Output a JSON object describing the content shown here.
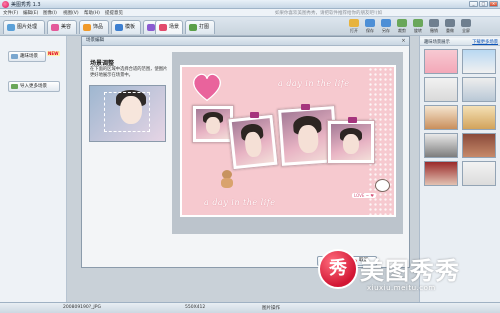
{
  "window": {
    "title": "美图秀秀 1.3",
    "controls": [
      "_",
      "□",
      "×"
    ]
  },
  "menu": {
    "items": [
      "文件(F)",
      "编辑(E)",
      "图像(I)",
      "视图(V)",
      "帮助(H)",
      "提提意见"
    ],
    "notice": "如果你喜欢美图秀秀，请把软件推荐给你的朋友吧!(如"
  },
  "tabs": [
    {
      "label": "图片处理",
      "color": "#5aa0d8"
    },
    {
      "label": "美容",
      "color": "#e45a9a"
    },
    {
      "label": "饰品",
      "color": "#f09a2a"
    },
    {
      "label": "模板",
      "color": "#3d7fd0"
    },
    {
      "label": "闪图",
      "color": "#8b5bd1"
    },
    {
      "label": "场景",
      "color": "#e24a6c"
    },
    {
      "label": "打图",
      "color": "#5b9f48"
    }
  ],
  "toolbar": {
    "buttons": [
      {
        "label": "打开",
        "color": "#e7b33e"
      },
      {
        "label": "保存",
        "color": "#4d8fd6"
      },
      {
        "label": "另存",
        "color": "#4d8fd6"
      },
      {
        "label": "裁剪",
        "color": "#6aa75a"
      },
      {
        "label": "旋转",
        "color": "#6aa75a"
      },
      {
        "label": "撤销",
        "color": "#6f7f8f"
      },
      {
        "label": "重做",
        "color": "#6f7f8f"
      },
      {
        "label": "全屏",
        "color": "#6f7f8f"
      }
    ]
  },
  "leftpanel": {
    "scene_button": "趣味场景",
    "new_badge": "NEW",
    "import_button": "导入更多场景"
  },
  "dialog": {
    "title": "场景编辑",
    "close": "×",
    "howto_title": "场景调整",
    "howto_text": "在下面的区域中选择合适的范围，使图片更好地展示在场景中。",
    "ok_label": "确定",
    "cancel_label": "取消"
  },
  "scene": {
    "text_top": "a day in the life",
    "text_bottom": "a day in the life",
    "love_tag": "LOVE ~ ♥"
  },
  "rightpanel": {
    "title": "趣味场景展示",
    "link": "下载更多场景"
  },
  "statusbar": {
    "filename": "200809190?_JPG",
    "size": "550X412",
    "mode": "图片操作"
  },
  "watermark": {
    "seal": "秀",
    "name": "美图秀秀",
    "url": "xiuxiu.meitu.com"
  },
  "colors": {
    "accent": "#e24a6c",
    "scene_bg": "#f6c9cf",
    "link": "#0b53b8"
  }
}
